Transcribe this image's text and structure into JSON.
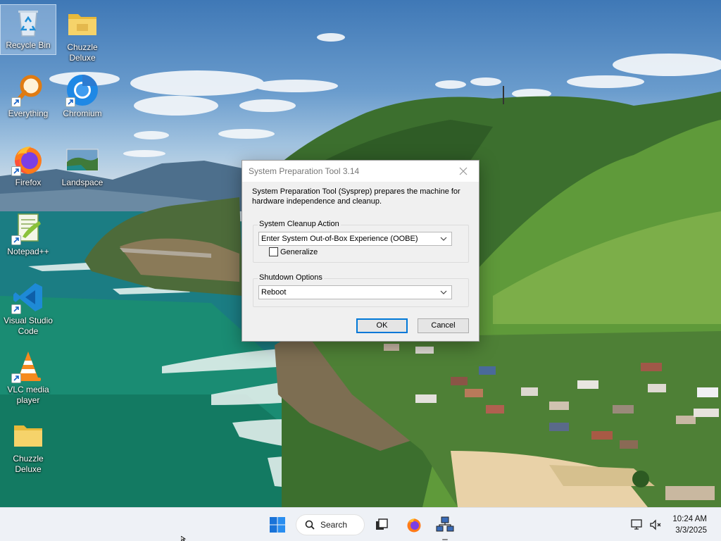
{
  "desktop": {
    "icons": [
      {
        "label": "Recycle Bin",
        "icon": "recycle-bin-icon"
      },
      {
        "label": "Chuzzle Deluxe",
        "icon": "folder-icon"
      },
      {
        "label": "Everything",
        "icon": "everything-search-icon"
      },
      {
        "label": "Chromium",
        "icon": "chromium-icon"
      },
      {
        "label": "Firefox",
        "icon": "firefox-icon"
      },
      {
        "label": "Landspace",
        "icon": "landscape-image-icon"
      },
      {
        "label": "Notepad++",
        "icon": "notepad-plus-plus-icon"
      },
      {
        "label": "Visual Studio Code",
        "icon": "vscode-icon"
      },
      {
        "label": "VLC media player",
        "icon": "vlc-icon"
      },
      {
        "label": "Chuzzle Deluxe",
        "icon": "folder-icon"
      }
    ]
  },
  "dialog": {
    "title": "System Preparation Tool 3.14",
    "description": "System Preparation Tool (Sysprep) prepares the machine for hardware independence and cleanup.",
    "cleanup_group": {
      "label": "System Cleanup Action",
      "selected": "Enter System Out-of-Box Experience (OOBE)",
      "generalize_label": "Generalize",
      "generalize_checked": false
    },
    "shutdown_group": {
      "label": "Shutdown Options",
      "selected": "Reboot"
    },
    "ok_label": "OK",
    "cancel_label": "Cancel"
  },
  "taskbar": {
    "search_label": "Search",
    "apps": [
      "start-icon",
      "search-icon",
      "task-view-icon",
      "firefox-icon",
      "network-app-icon"
    ],
    "time": "10:24 AM",
    "date": "3/3/2025"
  }
}
